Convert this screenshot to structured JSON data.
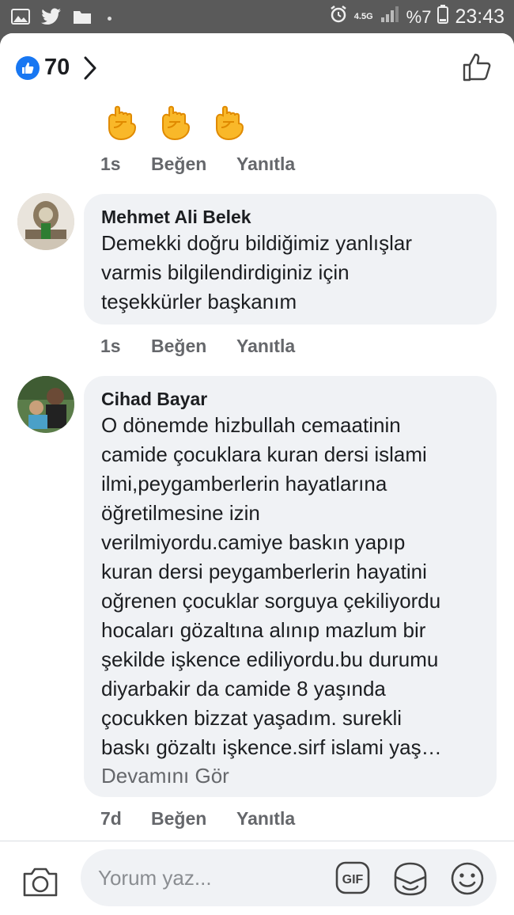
{
  "status_bar": {
    "network": "4.5G",
    "battery": "%7",
    "time": "23:43",
    "icons": [
      "gallery-icon",
      "twitter-icon",
      "folder-icon",
      "alarm-icon",
      "signal-icon",
      "battery-icon"
    ]
  },
  "header": {
    "reaction_count": "70",
    "icons": [
      "like-reaction-icon",
      "chevron-right-icon",
      "thumbs-up-icon"
    ]
  },
  "comments": [
    {
      "emojis": [
        "✊",
        "✊",
        "✊"
      ],
      "time": "1s",
      "like_label": "Beğen",
      "reply_label": "Yanıtla"
    },
    {
      "author": "Mehmet Ali Belek",
      "text_lines": [
        "Demekki doğru bildiğimiz yanlışlar",
        "varmis bilgilendirdiginiz için",
        "teşekkürler başkanım"
      ],
      "time": "1s",
      "like_label": "Beğen",
      "reply_label": "Yanıtla"
    },
    {
      "author": "Cihad Bayar",
      "text_lines": [
        "O dönemde hizbullah cemaatinin",
        "camide çocuklara kuran dersi islami",
        "ilmi,peygamberlerin hayatlarına",
        "öğretilmesine izin",
        "verilmiyordu.camiye baskın yapıp",
        "kuran dersi peygamberlerin hayatini",
        "oğrenen çocuklar sorguya çekiliyordu",
        "hocaları gözaltına alınıp mazlum bir",
        "şekilde işkence ediliyordu.bu durumu",
        "diyarbakir da camide 8 yaşında",
        "çocukken bizzat yaşadım. surekli",
        "baskı gözaltı işkence.sirf islami yaş…"
      ],
      "see_more": "Devamını Gör",
      "time": "7d",
      "like_label": "Beğen",
      "reply_label": "Yanıtla"
    }
  ],
  "composer": {
    "placeholder": "Yorum yaz...",
    "gif_label": "GIF",
    "icons": [
      "camera-icon",
      "gif-icon",
      "sticker-icon",
      "emoji-icon"
    ]
  }
}
